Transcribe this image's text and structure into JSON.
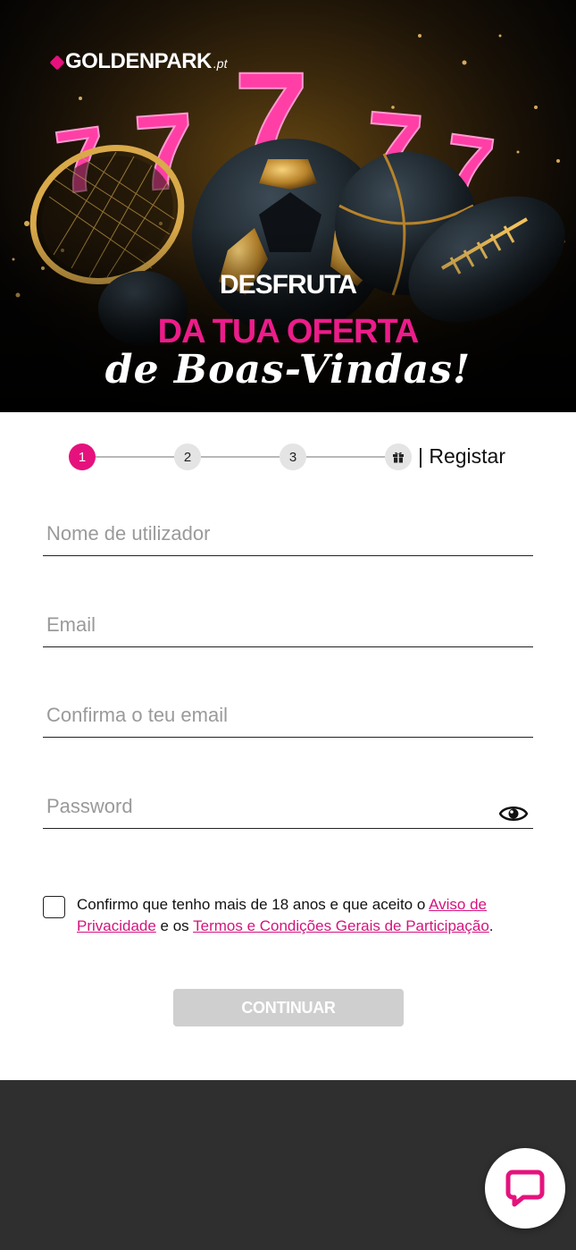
{
  "hero": {
    "logo_text": "GOLDENPARK",
    "logo_suffix": ".pt",
    "headline_1": "DESFRUTA",
    "headline_2": "DA TUA OFERTA",
    "headline_3": "de Boas-Vindas!",
    "lucky_digit": "7"
  },
  "stepper": {
    "steps": [
      {
        "number": "1",
        "state": "active"
      },
      {
        "number": "2",
        "state": "inactive"
      },
      {
        "number": "3",
        "state": "inactive"
      }
    ],
    "final_icon": "gift-icon",
    "label": "| Registar"
  },
  "form": {
    "username": {
      "value": "",
      "placeholder": "Nome de utilizador"
    },
    "email": {
      "value": "",
      "placeholder": "Email"
    },
    "confirm_email": {
      "value": "",
      "placeholder": "Confirma o teu email"
    },
    "password": {
      "value": "",
      "placeholder": "Password",
      "toggle_icon": "eye-icon"
    },
    "consent": {
      "checked": false,
      "text_before": "Confirmo que tenho mais de 18 anos e que aceito o ",
      "privacy_link": "Aviso de Privacidade",
      "text_middle": " e os ",
      "terms_link": "Termos e Condições Gerais de Participação",
      "text_after": "."
    },
    "continue_label": "CONTINUAR"
  },
  "chat": {
    "icon": "chat-bubble-icon"
  },
  "colors": {
    "brand_pink": "#e5127d",
    "link_pink": "#d4147e",
    "disabled_button": "#cfcfcf",
    "footer_bg": "#2f2f2f"
  }
}
